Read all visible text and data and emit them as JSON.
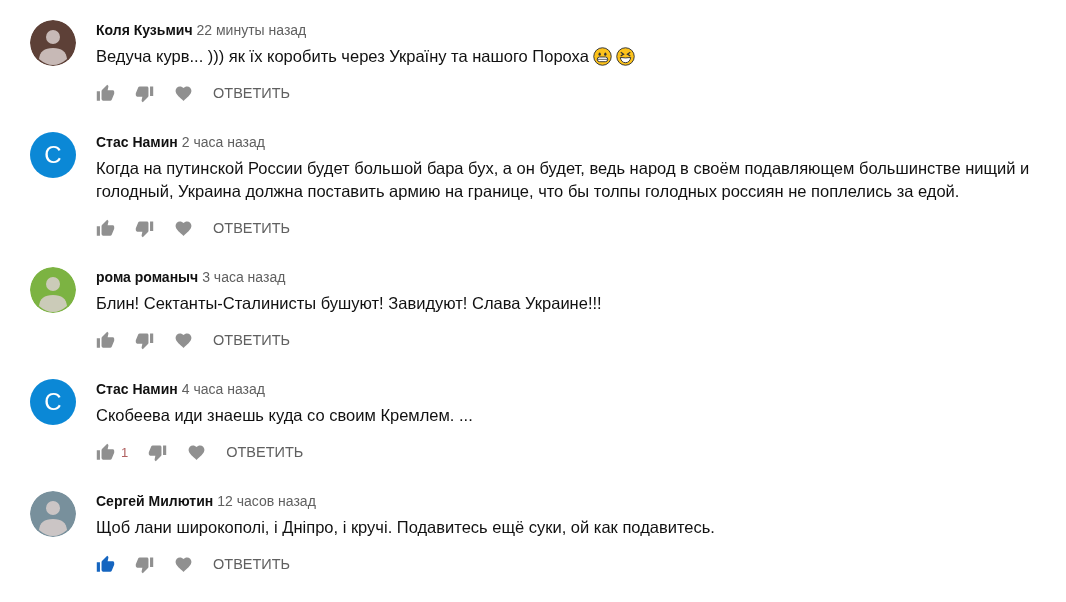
{
  "comments": [
    {
      "avatar": {
        "kind": "silhouette",
        "color": "#5d4037"
      },
      "author": "Коля Кузьмич",
      "time": "22 минуты назад",
      "text": "Ведуча курв... ))) як їх коробить через Україну та нашого Пороха",
      "emojis": [
        {
          "kind": "grin"
        },
        {
          "kind": "laugh"
        }
      ],
      "liked": false,
      "reply": "ОТВЕТИТЬ"
    },
    {
      "avatar": {
        "kind": "letter",
        "letter": "С",
        "color": "#0b88d6"
      },
      "author": "Стас Намин",
      "time": "2 часа назад",
      "text": "Когда на путинской России будет большой бара бух, а он будет, ведь народ в своём подавляющем большинстве нищий и голодный, Украина должна поставить армию на границе, что бы толпы голодных россиян не поплелись за едой.",
      "liked": false,
      "reply": "ОТВЕТИТЬ"
    },
    {
      "avatar": {
        "kind": "silhouette",
        "color": "#7cb342"
      },
      "author": "рома романыч",
      "time": "3 часа назад",
      "text": "Блин! Сектанты-Сталинисты бушуют! Завидуют! Слава Украине!!!",
      "liked": false,
      "reply": "ОТВЕТИТЬ"
    },
    {
      "avatar": {
        "kind": "letter",
        "letter": "С",
        "color": "#0b88d6"
      },
      "author": "Стас Намин",
      "time": "4 часа назад",
      "text": "Скобеева иди знаешь куда со своим Кремлем. ...",
      "likes": "1",
      "liked": false,
      "reply": "ОТВЕТИТЬ"
    },
    {
      "avatar": {
        "kind": "silhouette",
        "color": "#78909c"
      },
      "author": "Сергей Милютин",
      "time": "12 часов назад",
      "text": "Щоб лани широкополі, і Дніпро, і кручі. Подавитесь ещё суки, ой как подавитесь.",
      "liked": true,
      "reply": "ОТВЕТИТЬ"
    }
  ]
}
